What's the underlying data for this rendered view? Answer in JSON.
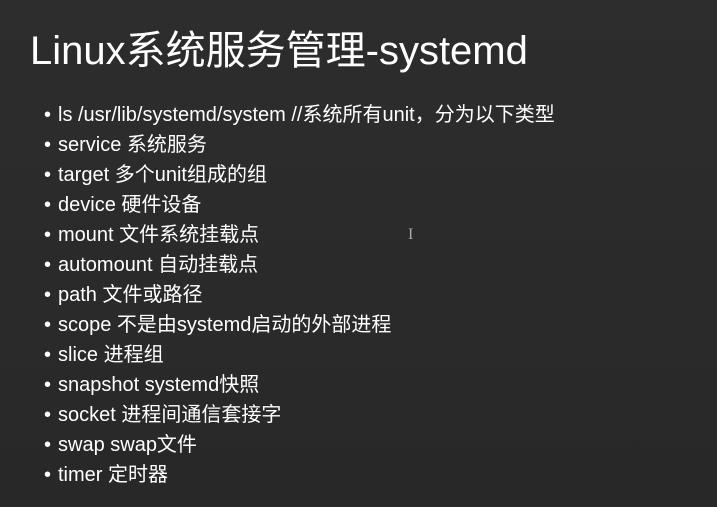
{
  "title": "Linux系统服务管理-systemd",
  "items": [
    "ls /usr/lib/systemd/system //系统所有unit，分为以下类型",
    "service 系统服务",
    "target 多个unit组成的组",
    "device 硬件设备",
    "mount 文件系统挂载点",
    "automount 自动挂载点",
    "path 文件或路径",
    "scope 不是由systemd启动的外部进程",
    "slice 进程组",
    "snapshot systemd快照",
    "socket 进程间通信套接字",
    "swap  swap文件",
    "timer 定时器"
  ],
  "cursor": "I"
}
